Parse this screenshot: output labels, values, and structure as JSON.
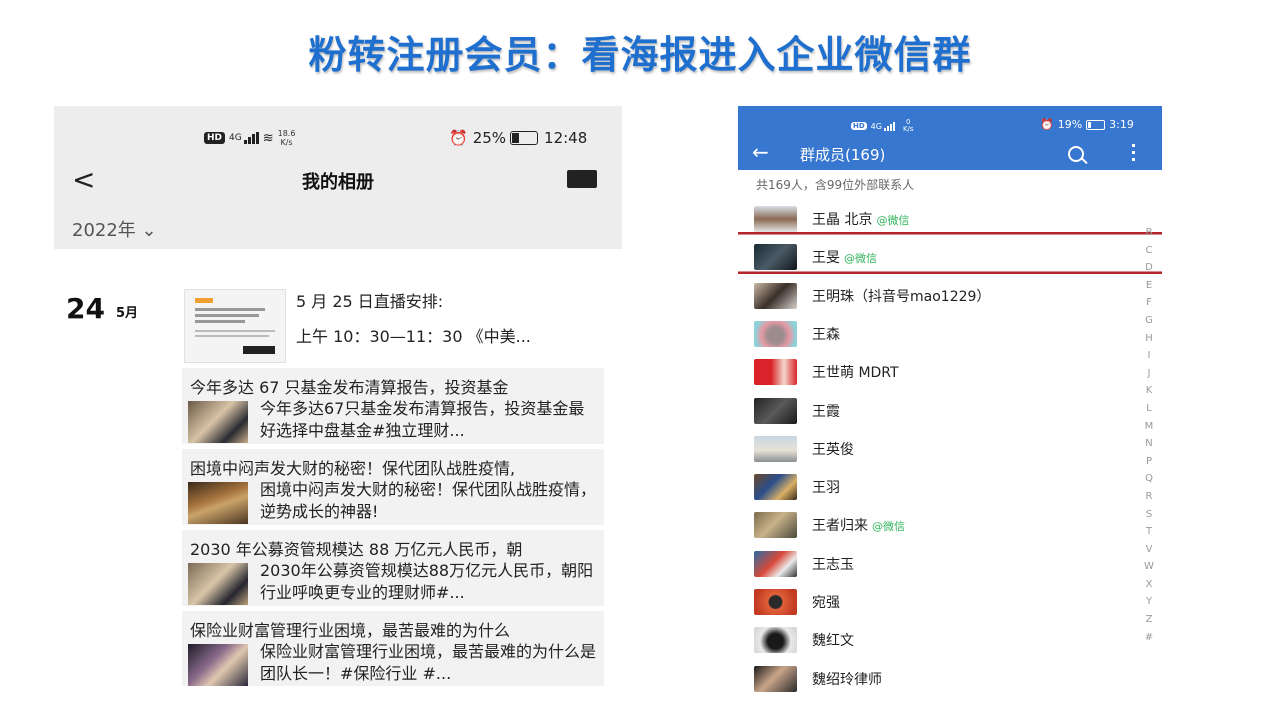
{
  "slide": {
    "title": "粉转注册会员：看海报进入企业微信群"
  },
  "left_phone": {
    "status": {
      "hd": "HD",
      "net_type": "4G",
      "speed_value": "18.6",
      "speed_unit": "K/s",
      "battery": "25%",
      "time": "12:48"
    },
    "nav": {
      "back": "<",
      "title": "我的相册"
    },
    "year_filter": "2022年 ⌄",
    "post": {
      "day": "24",
      "month": "5月",
      "line1": "5 月 25 日直播安排:",
      "line2": "上午 10：30—11：30 《中美..."
    },
    "shares": [
      {
        "title": "今年多达 67 只基金发布清算报告，投资基金",
        "text": "今年多达67只基金发布清算报告，投资基金最好选择中盘基金#独立理财..."
      },
      {
        "title": "困境中闷声发大财的秘密！保代团队战胜疫情,",
        "text": "困境中闷声发大财的秘密！保代团队战胜疫情，逆势成长的神器!"
      },
      {
        "title": "2030 年公募资管规模达 88 万亿元人民币，朝",
        "text": "2030年公募资管规模达88万亿元人民币，朝阳行业呼唤更专业的理财师#..."
      },
      {
        "title": "保险业财富管理行业困境，最苦最难的为什么",
        "text": "保险业财富管理行业困境，最苦最难的为什么是团队长一！#保险行业 #..."
      }
    ]
  },
  "right_phone": {
    "status": {
      "net": "4G",
      "speed_value": "0",
      "speed_unit": "K/s",
      "battery": "19%",
      "time": "3:19"
    },
    "nav": {
      "back": "←",
      "title": "群成员(169)"
    },
    "summary": "共169人，含99位外部联系人",
    "members": [
      {
        "name": "王晶 北京",
        "tag": "@微信"
      },
      {
        "name": "王旻",
        "tag": "@微信"
      },
      {
        "name": "王明珠（抖音号mao1229）",
        "tag": ""
      },
      {
        "name": "王森",
        "tag": ""
      },
      {
        "name": "王世萌 MDRT",
        "tag": ""
      },
      {
        "name": "王霞",
        "tag": ""
      },
      {
        "name": "王英俊",
        "tag": ""
      },
      {
        "name": "王羽",
        "tag": ""
      },
      {
        "name": "王者归来",
        "tag": "@微信"
      },
      {
        "name": "王志玉",
        "tag": ""
      },
      {
        "name": "宛强",
        "tag": ""
      },
      {
        "name": "魏红文",
        "tag": ""
      },
      {
        "name": "魏绍玲律师",
        "tag": ""
      }
    ],
    "alphabet": [
      "B",
      "C",
      "D",
      "E",
      "F",
      "G",
      "H",
      "I",
      "J",
      "K",
      "L",
      "M",
      "N",
      "P",
      "Q",
      "R",
      "S",
      "T",
      "V",
      "W",
      "X",
      "Y",
      "Z",
      "#"
    ]
  },
  "colors": {
    "title_blue": "#1f6fcf",
    "header_blue": "#3777cf",
    "highlight_red": "#b3262c",
    "wechat_green": "#2fb35a"
  }
}
